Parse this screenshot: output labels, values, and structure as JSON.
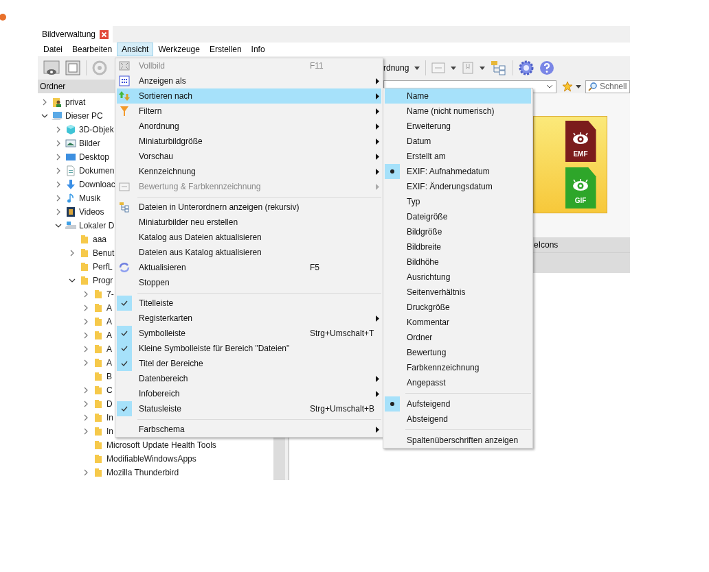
{
  "tabs": [
    {
      "label": "Bildverwaltung",
      "selected": true
    }
  ],
  "menubar": [
    {
      "label": "Datei",
      "selected": false
    },
    {
      "label": "Bearbeiten",
      "selected": false
    },
    {
      "label": "Ansicht",
      "selected": true
    },
    {
      "label": "Werkzeuge",
      "selected": false
    },
    {
      "label": "Erstellen",
      "selected": false
    },
    {
      "label": "Info",
      "selected": false
    }
  ],
  "toolbar": {
    "sort_button": "rdnung"
  },
  "folders_panel": {
    "title": "Ordner",
    "tree": [
      {
        "label": "privat",
        "expandable": true,
        "expanded": false
      },
      {
        "label": "Dieser PC",
        "expandable": true,
        "expanded": true,
        "children": [
          {
            "label": "3D-Objek",
            "expandable": true,
            "expanded": false
          },
          {
            "label": "Bilder",
            "expandable": true,
            "expanded": false
          },
          {
            "label": "Desktop",
            "expandable": true,
            "expanded": false
          },
          {
            "label": "Dokumen",
            "expandable": true,
            "expanded": false
          },
          {
            "label": "Downloac",
            "expandable": true,
            "expanded": false
          },
          {
            "label": "Musik",
            "expandable": true,
            "expanded": false
          },
          {
            "label": "Videos",
            "expandable": true,
            "expanded": false
          },
          {
            "label": "Lokaler D",
            "expandable": true,
            "expanded": true,
            "children": [
              {
                "label": "aaa",
                "expandable": false,
                "expanded": false
              },
              {
                "label": "Benut",
                "expandable": true,
                "expanded": false
              },
              {
                "label": "PerfL",
                "expandable": false,
                "expanded": false
              },
              {
                "label": "Progr",
                "expandable": true,
                "expanded": true,
                "children": [
                  {
                    "label": "7-",
                    "expandable": true,
                    "expanded": false
                  },
                  {
                    "label": "A",
                    "expandable": true,
                    "expanded": false
                  },
                  {
                    "label": "A",
                    "expandable": true,
                    "expanded": false
                  },
                  {
                    "label": "A",
                    "expandable": true,
                    "expanded": false
                  },
                  {
                    "label": "A",
                    "expandable": true,
                    "expanded": false
                  },
                  {
                    "label": "A",
                    "expandable": true,
                    "expanded": false
                  },
                  {
                    "label": "B",
                    "expandable": false,
                    "expanded": false
                  },
                  {
                    "label": "C",
                    "expandable": true,
                    "expanded": false
                  },
                  {
                    "label": "D",
                    "expandable": true,
                    "expanded": false
                  },
                  {
                    "label": "In",
                    "expandable": true,
                    "expanded": false
                  },
                  {
                    "label": "In",
                    "expandable": true,
                    "expanded": false
                  },
                  {
                    "label": "Microsoft Update Health Tools",
                    "expandable": false,
                    "expanded": false
                  },
                  {
                    "label": "ModifiableWindowsApps",
                    "expandable": false,
                    "expanded": false
                  },
                  {
                    "label": "Mozilla Thunderbird",
                    "expandable": true,
                    "expanded": false
                  }
                ]
              }
            ]
          }
        ]
      }
    ]
  },
  "search": {
    "placeholder": "Schnell"
  },
  "content": {
    "row_text": "eIcons",
    "thumbnails": [
      {
        "label": "EMF",
        "color": "#7b1c1c"
      },
      {
        "label": "GIF",
        "color": "#2ea62a"
      }
    ]
  },
  "view_menu": {
    "items": [
      {
        "kind": "item",
        "label": "Vollbild",
        "shortcut": "F11",
        "submenu": false,
        "disabled": true,
        "checked": false,
        "highlighted": false
      },
      {
        "kind": "item",
        "label": "Anzeigen als",
        "submenu": true,
        "disabled": false,
        "checked": false,
        "highlighted": false
      },
      {
        "kind": "item",
        "label": "Sortieren nach",
        "submenu": true,
        "disabled": false,
        "checked": false,
        "highlighted": true
      },
      {
        "kind": "item",
        "label": "Filtern",
        "submenu": true,
        "disabled": false,
        "checked": false,
        "highlighted": false
      },
      {
        "kind": "item",
        "label": "Anordnung",
        "submenu": true,
        "disabled": false,
        "checked": false,
        "highlighted": false
      },
      {
        "kind": "item",
        "label": "Miniaturbildgröße",
        "submenu": true,
        "disabled": false,
        "checked": false,
        "highlighted": false
      },
      {
        "kind": "item",
        "label": "Vorschau",
        "submenu": true,
        "disabled": false,
        "checked": false,
        "highlighted": false
      },
      {
        "kind": "item",
        "label": "Kennzeichnung",
        "submenu": true,
        "disabled": false,
        "checked": false,
        "highlighted": false
      },
      {
        "kind": "item",
        "label": "Bewertung & Farbkennzeichnung",
        "submenu": true,
        "disabled": true,
        "checked": false,
        "highlighted": false
      },
      {
        "kind": "separator"
      },
      {
        "kind": "item",
        "label": "Dateien in Unterordnern anzeigen (rekursiv)",
        "submenu": false,
        "disabled": false,
        "checked": false,
        "highlighted": false
      },
      {
        "kind": "item",
        "label": "Miniaturbilder neu erstellen",
        "submenu": false,
        "disabled": false,
        "checked": false,
        "highlighted": false
      },
      {
        "kind": "item",
        "label": "Katalog aus Dateien aktualisieren",
        "submenu": false,
        "disabled": false,
        "checked": false,
        "highlighted": false
      },
      {
        "kind": "item",
        "label": "Dateien aus Katalog aktualisieren",
        "submenu": false,
        "disabled": false,
        "checked": false,
        "highlighted": false
      },
      {
        "kind": "item",
        "label": "Aktualisieren",
        "shortcut": "F5",
        "submenu": false,
        "disabled": false,
        "checked": false,
        "highlighted": false
      },
      {
        "kind": "item",
        "label": "Stoppen",
        "submenu": false,
        "disabled": false,
        "checked": false,
        "highlighted": false
      },
      {
        "kind": "separator"
      },
      {
        "kind": "item",
        "label": "Titelleiste",
        "submenu": false,
        "disabled": false,
        "checked": true,
        "highlighted": false
      },
      {
        "kind": "item",
        "label": "Registerkarten",
        "submenu": true,
        "disabled": false,
        "checked": false,
        "highlighted": false
      },
      {
        "kind": "item",
        "label": "Symbolleiste",
        "shortcut": "Strg+Umschalt+T",
        "submenu": false,
        "disabled": false,
        "checked": true,
        "highlighted": false
      },
      {
        "kind": "item",
        "label": "Kleine Symbolleiste für Bereich \"Dateien\"",
        "submenu": false,
        "disabled": false,
        "checked": true,
        "highlighted": false
      },
      {
        "kind": "item",
        "label": "Titel der Bereiche",
        "submenu": false,
        "disabled": false,
        "checked": true,
        "highlighted": false
      },
      {
        "kind": "item",
        "label": "Datenbereich",
        "submenu": true,
        "disabled": false,
        "checked": false,
        "highlighted": false
      },
      {
        "kind": "item",
        "label": "Infobereich",
        "submenu": true,
        "disabled": false,
        "checked": false,
        "highlighted": false
      },
      {
        "kind": "item",
        "label": "Statusleiste",
        "shortcut": "Strg+Umschalt+B",
        "submenu": false,
        "disabled": false,
        "checked": true,
        "highlighted": false
      },
      {
        "kind": "separator"
      },
      {
        "kind": "item",
        "label": "Farbschema",
        "submenu": true,
        "disabled": false,
        "checked": false,
        "highlighted": false
      }
    ]
  },
  "sort_submenu": {
    "items": [
      {
        "kind": "item",
        "label": "Name",
        "checked": false,
        "highlighted": true
      },
      {
        "kind": "item",
        "label": "Name (nicht numerisch)",
        "checked": false,
        "highlighted": false
      },
      {
        "kind": "item",
        "label": "Erweiterung",
        "checked": false,
        "highlighted": false
      },
      {
        "kind": "item",
        "label": "Datum",
        "checked": false,
        "highlighted": false
      },
      {
        "kind": "item",
        "label": "Erstellt am",
        "checked": false,
        "highlighted": false
      },
      {
        "kind": "item",
        "label": "EXIF: Aufnahmedatum",
        "checked": true,
        "highlighted": false
      },
      {
        "kind": "item",
        "label": "EXIF: Änderungsdatum",
        "checked": false,
        "highlighted": false
      },
      {
        "kind": "item",
        "label": "Typ",
        "checked": false,
        "highlighted": false
      },
      {
        "kind": "item",
        "label": "Dateigröße",
        "checked": false,
        "highlighted": false
      },
      {
        "kind": "item",
        "label": "Bildgröße",
        "checked": false,
        "highlighted": false
      },
      {
        "kind": "item",
        "label": "Bildbreite",
        "checked": false,
        "highlighted": false
      },
      {
        "kind": "item",
        "label": "Bildhöhe",
        "checked": false,
        "highlighted": false
      },
      {
        "kind": "item",
        "label": "Ausrichtung",
        "checked": false,
        "highlighted": false
      },
      {
        "kind": "item",
        "label": "Seitenverhältnis",
        "checked": false,
        "highlighted": false
      },
      {
        "kind": "item",
        "label": "Druckgröße",
        "checked": false,
        "highlighted": false
      },
      {
        "kind": "item",
        "label": "Kommentar",
        "checked": false,
        "highlighted": false
      },
      {
        "kind": "item",
        "label": "Ordner",
        "checked": false,
        "highlighted": false
      },
      {
        "kind": "item",
        "label": "Bewertung",
        "checked": false,
        "highlighted": false
      },
      {
        "kind": "item",
        "label": "Farbkennzeichnung",
        "checked": false,
        "highlighted": false
      },
      {
        "kind": "item",
        "label": "Angepasst",
        "checked": false,
        "highlighted": false
      },
      {
        "kind": "separator"
      },
      {
        "kind": "item",
        "label": "Aufsteigend",
        "checked": true,
        "highlighted": false
      },
      {
        "kind": "item",
        "label": "Absteigend",
        "checked": false,
        "highlighted": false
      },
      {
        "kind": "separator"
      },
      {
        "kind": "item",
        "label": "Spaltenüberschriften anzeigen",
        "checked": false,
        "highlighted": false
      }
    ]
  }
}
